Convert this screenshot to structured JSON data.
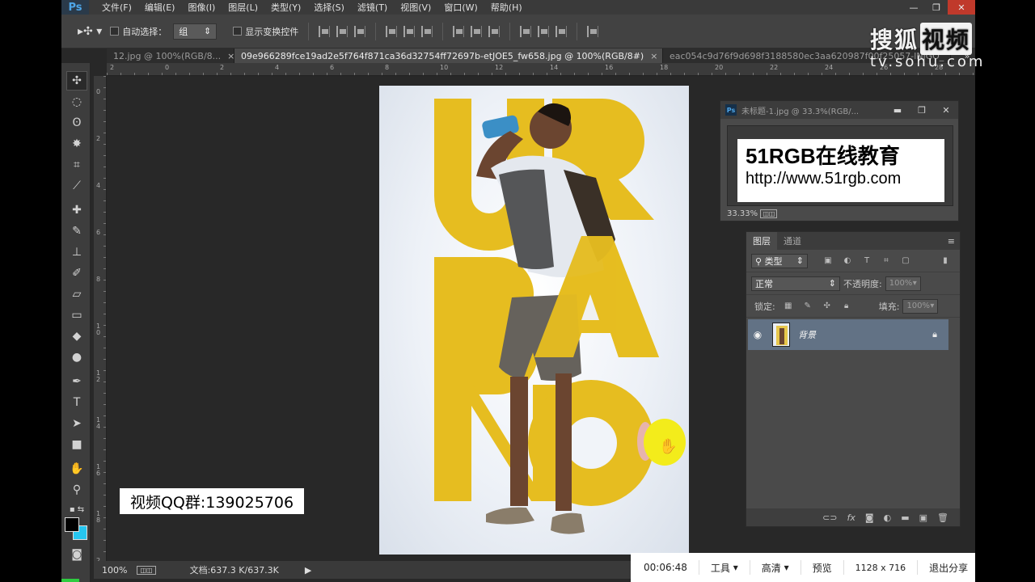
{
  "app": {
    "logo": "Ps"
  },
  "menu": [
    "文件(F)",
    "编辑(E)",
    "图像(I)",
    "图层(L)",
    "类型(Y)",
    "选择(S)",
    "滤镜(T)",
    "视图(V)",
    "窗口(W)",
    "帮助(H)"
  ],
  "window_controls": {
    "minimize": "—",
    "restore": "❐",
    "close": "✕"
  },
  "options": {
    "auto_select_label": "自动选择：",
    "auto_select_value": "组",
    "show_transform_label": "显示变换控件"
  },
  "tabs": [
    {
      "label": "12.jpg @ 100%(RGB/8...",
      "close": "×"
    },
    {
      "label": "09e966289fce19ad2e5f764f871ca36d32754ff72697b-etJOE5_fw658.jpg @ 100%(RGB/8#)",
      "close": "×"
    },
    {
      "label": "eac054c9d76f9d698f3188580ec3aa620987f00f25057-lNjGO_",
      "close": ""
    }
  ],
  "tabs_more": "»",
  "ruler_top_labels": [
    "2",
    "0",
    "2",
    "4",
    "6",
    "8",
    "10",
    "12",
    "14",
    "16",
    "18",
    "20",
    "22",
    "24",
    "26",
    "28",
    "30",
    "32",
    "34"
  ],
  "ruler_left_labels": [
    "0",
    "2",
    "4",
    "6",
    "8",
    "1\n0",
    "1\n2",
    "1\n4",
    "1\n6",
    "1\n8",
    "2\n0"
  ],
  "canvas": {
    "letters": [
      "U",
      "R",
      "B",
      "A",
      "N",
      "O"
    ]
  },
  "status": {
    "zoom": "100%",
    "doc": "文档:637.3 K/637.3K",
    "arrow": "▶"
  },
  "navigator": {
    "title": "未标题-1.jpg @ 33.3%(RGB/...",
    "minimize": "▬",
    "restore": "❐",
    "close": "✕",
    "preview_title": "51RGB在线教育",
    "preview_url": "http://www.51rgb.com",
    "zoom": "33.33%"
  },
  "layers": {
    "tabs": [
      "图层",
      "通道"
    ],
    "filter_label": "类型",
    "blend_mode": "正常",
    "opacity_label": "不透明度:",
    "opacity_value": "100%",
    "lock_label": "锁定:",
    "fill_label": "填充:",
    "fill_value": "100%",
    "layer_name": "背景",
    "footer_icons": [
      "link-icon",
      "fx-icon",
      "mask-icon",
      "adjustment-icon",
      "folder-icon",
      "new-layer-icon",
      "trash-icon"
    ]
  },
  "overlay": {
    "qq_group": "视频QQ群:139025706",
    "sohu_logo_1": "搜狐",
    "sohu_logo_2": "视频",
    "sohu_url": "tv.sohu.com"
  },
  "player": {
    "time": "00:06:48",
    "tools": "工具",
    "quality": "高清",
    "preview": "预览",
    "resolution": "1128 x 716",
    "exit_share": "退出分享"
  }
}
